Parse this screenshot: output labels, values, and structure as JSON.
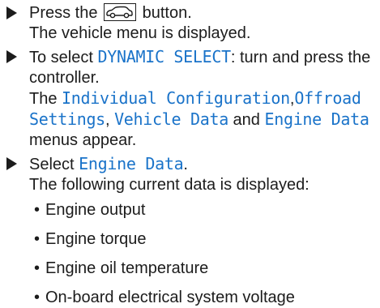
{
  "step1": {
    "pre": "Press the",
    "button_icon": "vehicle-icon",
    "post": "button.",
    "result": "The vehicle menu is displayed."
  },
  "step2": {
    "pre": "To select",
    "term": "DYNAMIC SELECT",
    "post": ": turn and press the controller.",
    "res_pre": "The",
    "term1": "Individual Configuration",
    "sep1": ",",
    "term2": "Offroad Settings",
    "sep2": ",",
    "term3": "Vehicle Data",
    "and": "and",
    "term4": "Engine Data",
    "res_post": "menus appear."
  },
  "step3": {
    "pre": "Select",
    "term": "Engine Data",
    "post": ".",
    "result": "The following current data is displayed:"
  },
  "bullet_char": "•",
  "bullets": [
    "Engine output",
    "Engine torque",
    "Engine oil temperature",
    "On-board electrical system voltage"
  ],
  "colors": {
    "term": "#1a73c9",
    "text": "#1c1c1c"
  }
}
